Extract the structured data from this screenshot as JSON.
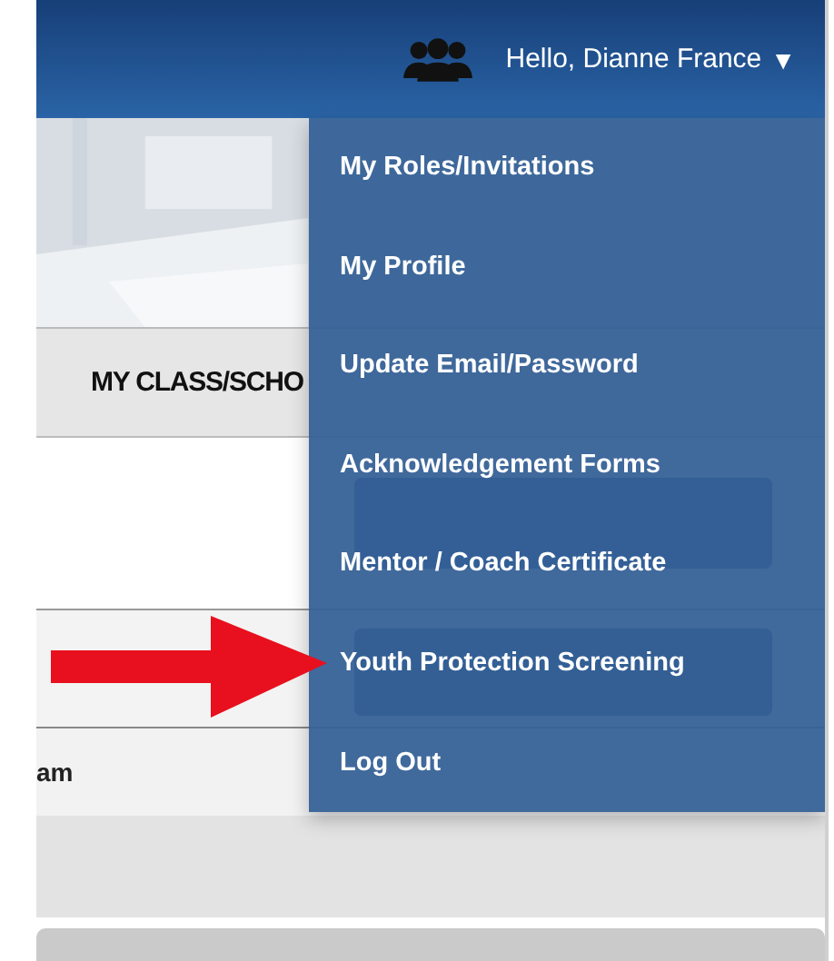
{
  "header": {
    "greeting": "Hello, Dianne France",
    "caret": "▼"
  },
  "tab_bar": {
    "label": "MY CLASS/SCHO"
  },
  "task_row": {
    "column_1": "am"
  },
  "user_menu": {
    "items": [
      {
        "label": "My Roles/Invitations"
      },
      {
        "label": "My Profile"
      },
      {
        "label": "Update Email/Password"
      },
      {
        "label": "Acknowledgement Forms"
      },
      {
        "label": "Mentor / Coach Certificate"
      },
      {
        "label": "Youth Protection Screening"
      },
      {
        "label": "Log Out"
      }
    ]
  }
}
